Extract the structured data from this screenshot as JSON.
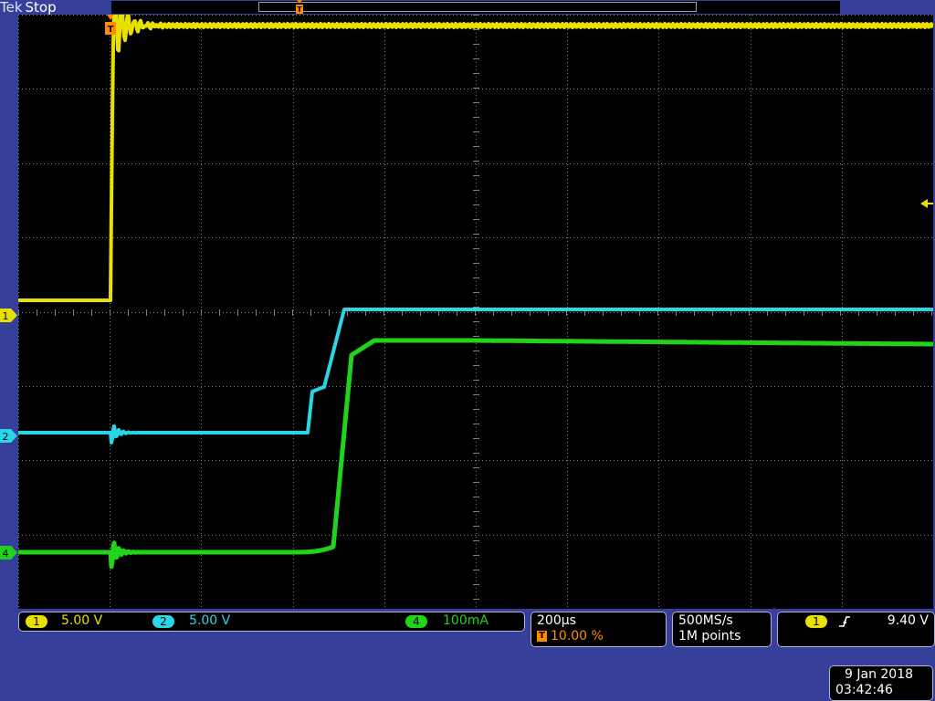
{
  "brand": {
    "vendor": "Tek",
    "state": "Stop"
  },
  "colors": {
    "ch1": "#e8e000",
    "ch2": "#28d6e6",
    "ch4": "#1fd41a",
    "trigger": "#ff8c00",
    "background": "#36409a",
    "screen": "#000000",
    "grid": "#808080"
  },
  "channels": [
    {
      "number": "1",
      "scale": "5.00 V"
    },
    {
      "number": "2",
      "scale": "5.00 V"
    },
    {
      "number": "4",
      "scale": "100mA"
    }
  ],
  "markers": {
    "ch1": "1",
    "ch2": "2",
    "ch4": "4",
    "trigger": "T"
  },
  "timebase": {
    "scale": "200µs",
    "trigger_position": "10.00 %"
  },
  "acquisition": {
    "sample_rate": "500MS/s",
    "record_length": "1M points"
  },
  "trigger": {
    "source": "1",
    "slope_icon": "rising-edge-icon",
    "level": "9.40 V"
  },
  "datetime": {
    "date": "9 Jan  2018",
    "time": "03:42:46"
  }
}
